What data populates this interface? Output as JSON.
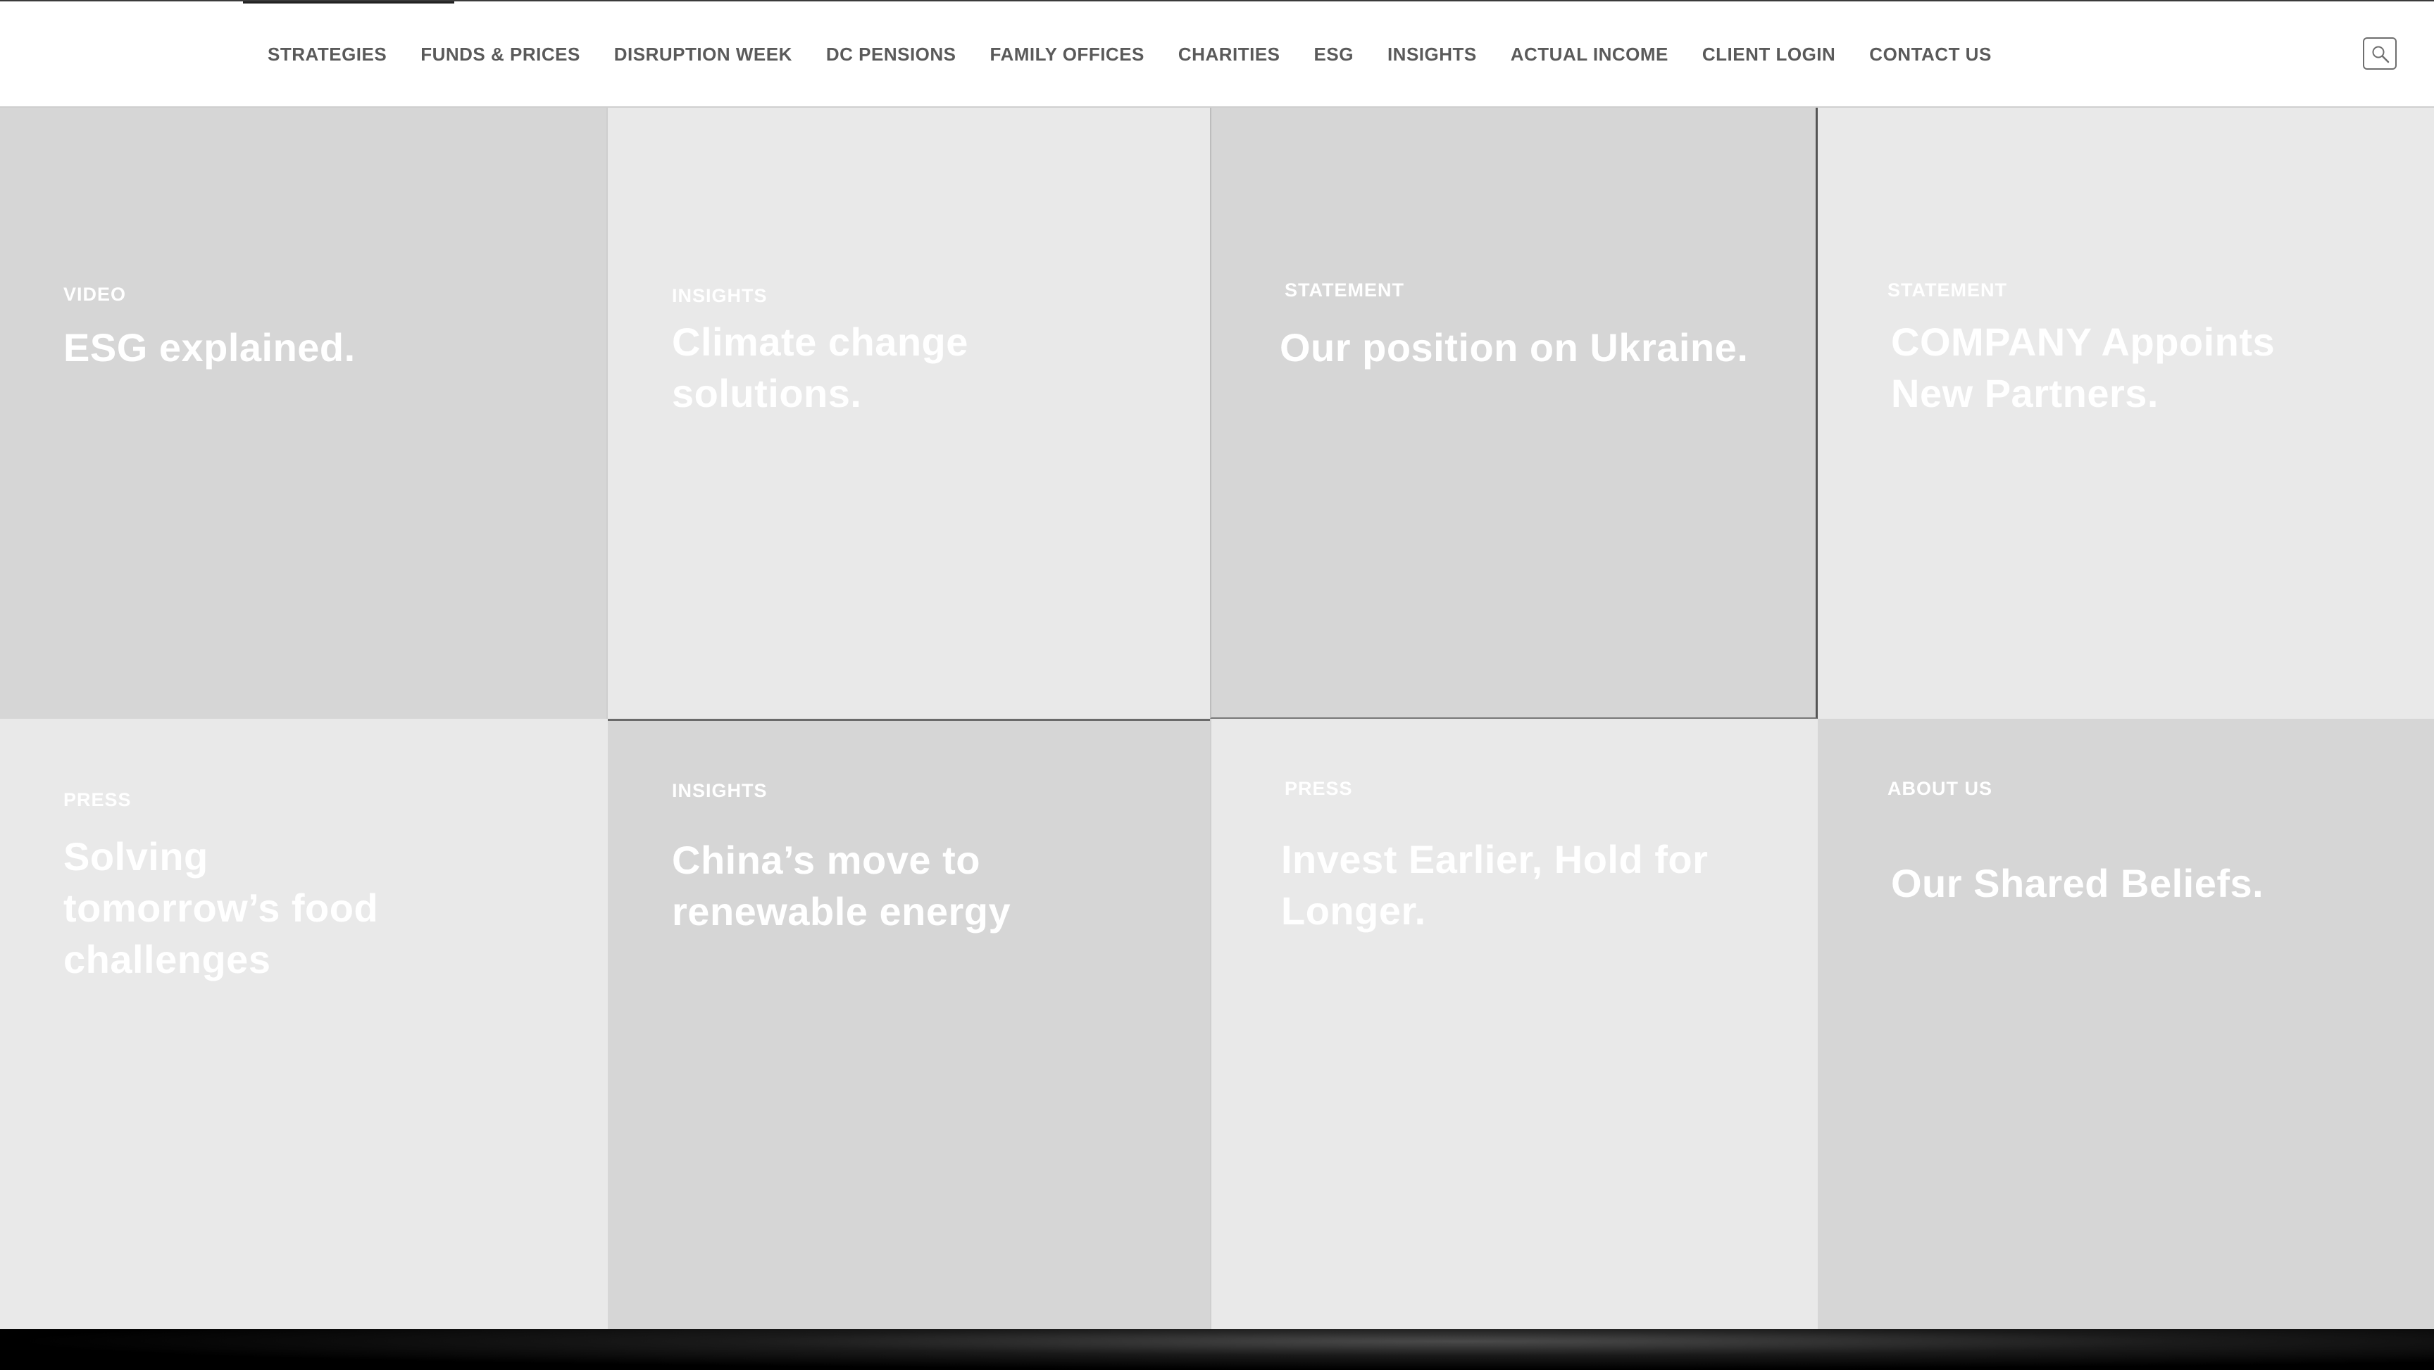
{
  "nav": {
    "items": [
      "STRATEGIES",
      "FUNDS & PRICES",
      "DISRUPTION WEEK",
      "DC PENSIONS",
      "FAMILY OFFICES",
      "CHARITIES",
      "ESG",
      "INSIGHTS",
      "ACTUAL INCOME",
      "CLIENT LOGIN",
      "CONTACT US"
    ],
    "search_icon": "search-icon"
  },
  "tiles": [
    {
      "kicker": "VIDEO",
      "title": "ESG explained."
    },
    {
      "kicker": "INSIGHTS",
      "title": "Climate change solutions."
    },
    {
      "kicker": "STATEMENT",
      "title": "Our position on Ukraine."
    },
    {
      "kicker": "STATEMENT",
      "title": "COMPANY Appoints New Partners."
    },
    {
      "kicker": "PRESS",
      "title": "Solving tomorrow’s food challenges"
    },
    {
      "kicker": "INSIGHTS",
      "title": "China’s move to renewable energy"
    },
    {
      "kicker": "PRESS",
      "title": "Invest Earlier, Hold for Longer."
    },
    {
      "kicker": "ABOUT US",
      "title": "Our Shared Beliefs."
    }
  ],
  "colors": {
    "tile_dark": "#d6d6d6",
    "tile_light": "#e9e9e9",
    "nav_text": "#5a5a5a",
    "tile_text": "#ffffff"
  }
}
